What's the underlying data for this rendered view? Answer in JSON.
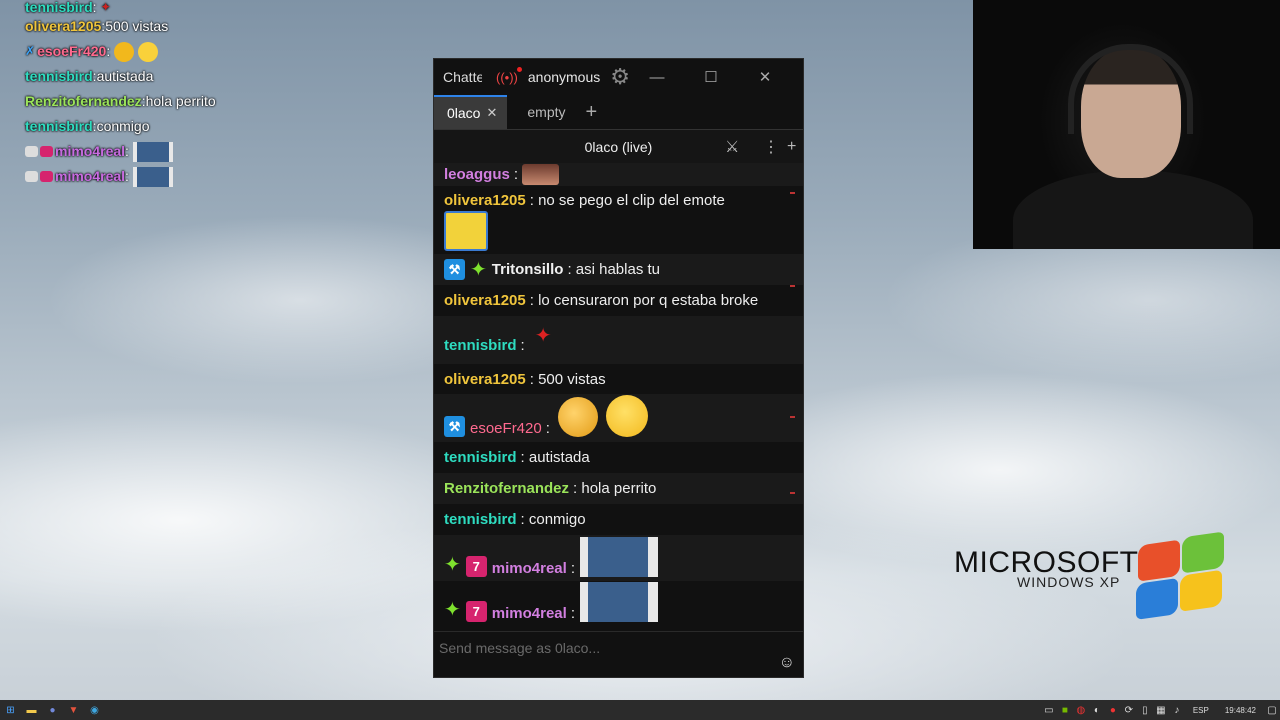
{
  "overlay": {
    "lines": [
      {
        "user": "tennisbird",
        "color": "#2edcc0",
        "text": ""
      },
      {
        "user": "olivera1205",
        "color": "#f0c53c",
        "text": " 500 vistas"
      },
      {
        "user": "esoeFr420",
        "color": "#ff6a8f",
        "text": ""
      },
      {
        "user": "tennisbird",
        "color": "#2edcc0",
        "text": " autistada"
      },
      {
        "user": "Renzitofernandez",
        "color": "#9be45a",
        "text": " hola perrito"
      },
      {
        "user": "tennisbird",
        "color": "#2edcc0",
        "text": " conmigo"
      },
      {
        "user": "mimo4real",
        "color": "#c86be0",
        "text": ""
      },
      {
        "user": "mimo4real",
        "color": "#c86be0",
        "text": ""
      }
    ]
  },
  "window": {
    "app_title": "Chatterino",
    "account": "anonymous",
    "tabs": [
      {
        "label": "0laco",
        "active": true
      },
      {
        "label": "empty",
        "active": false
      }
    ],
    "channel_title": "0laco (live)",
    "input_placeholder": "Send message as 0laco..."
  },
  "messages": [
    {
      "user": "leoaggus",
      "color": "#d27fe0",
      "text": ""
    },
    {
      "user": "olivera1205",
      "color": "#f0c53c",
      "text": "no se pego el clip del emote"
    },
    {
      "user": "Tritonsillo",
      "color": "#f0f0f0",
      "text": "asi hablas tu"
    },
    {
      "user": "olivera1205",
      "color": "#f0c53c",
      "text": "lo censuraron por q estaba broke"
    },
    {
      "user": "tennisbird",
      "color": "#2edcc0",
      "text": ""
    },
    {
      "user": "olivera1205",
      "color": "#f0c53c",
      "text": "500 vistas"
    },
    {
      "user": "esoeFr420",
      "color": "#ff6a8f",
      "text": ""
    },
    {
      "user": "tennisbird",
      "color": "#2edcc0",
      "text": "autistada"
    },
    {
      "user": "Renzitofernandez",
      "color": "#9be45a",
      "text": "hola perrito"
    },
    {
      "user": "tennisbird",
      "color": "#2edcc0",
      "text": "conmigo"
    },
    {
      "user": "mimo4real",
      "color": "#d27fe0",
      "text": ""
    },
    {
      "user": "mimo4real",
      "color": "#d27fe0",
      "text": ""
    }
  ],
  "branding": {
    "microsoft": "MICROSOFT",
    "windows": "WINDOWS XP"
  },
  "taskbar": {
    "language": "ESP",
    "time": "19:48:42"
  }
}
